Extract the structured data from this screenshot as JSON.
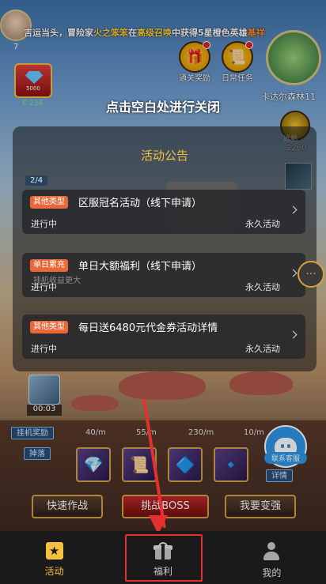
{
  "ticker": {
    "prefix": "吉运当头，冒险家",
    "player": "火之笨笨",
    "mid1": "在",
    "place": "高级召唤",
    "mid2": "中获得5星橙色英雄",
    "hero": "基祥"
  },
  "avatar": {
    "level": "7"
  },
  "rank": {
    "value": "5000",
    "sub": "E:234"
  },
  "top_buttons": [
    {
      "label": "通关奖励",
      "icon": "gift-icon"
    },
    {
      "label": "日常任务",
      "icon": "scroll-icon"
    }
  ],
  "minimap": {
    "label": "卡达尔森林11"
  },
  "close_hint": "点击空白处进行关闭",
  "side": {
    "circle_label": "远航",
    "number": "2260"
  },
  "panel": {
    "title": "活动公告",
    "page": "2/4",
    "events": [
      {
        "badge": "其他类型",
        "title": "区服冠名活动（线下申请）",
        "status": "进行中",
        "duration": "永久活动"
      },
      {
        "badge": "单日累充",
        "title": "单日大额福利（线下申请）",
        "status": "进行中",
        "duration": "永久活动"
      },
      {
        "badge": "其他类型",
        "title": "每日送6480元代金券活动详情",
        "status": "进行中",
        "duration": "永久活动"
      }
    ]
  },
  "behind_text": "挂机收益更大",
  "hud": {
    "timer": "00:03",
    "tag_idle": "挂机奖励",
    "tag_drop": "掉落",
    "tag_detail": "详情",
    "stats": [
      "40/m",
      "55/m",
      "230/m",
      "10/m"
    ],
    "support_label": "联系客服",
    "actions": [
      "快速作战",
      "挑战BOSS",
      "我要变强"
    ]
  },
  "tabs": [
    {
      "label": "活动",
      "active": true
    },
    {
      "label": "福利",
      "active": false
    },
    {
      "label": "我的",
      "active": false
    }
  ],
  "colors": {
    "accent": "#f5c041",
    "badge": "#e8683a",
    "arrow": "#e53030",
    "support": "#2e97e8"
  }
}
